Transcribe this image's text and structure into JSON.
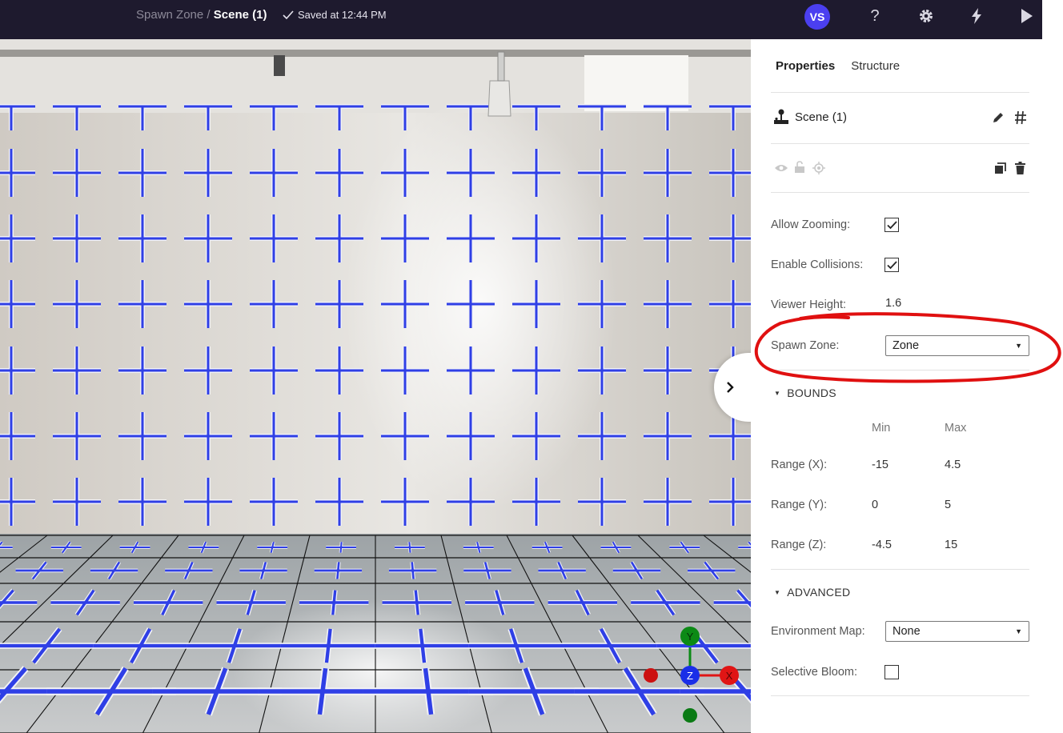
{
  "header": {
    "breadcrumb_parent": "Spawn Zone",
    "breadcrumb_separator": " / ",
    "breadcrumb_current": "Scene (1)",
    "saved_status": "Saved at 12:44 PM",
    "avatar_initials": "VS",
    "help_glyph": "?"
  },
  "panel": {
    "tabs": [
      {
        "label": "Properties",
        "active": true
      },
      {
        "label": "Structure",
        "active": false
      }
    ],
    "object_name": "Scene (1)",
    "object_icon": "joystick-icon",
    "properties": {
      "allow_zooming_label": "Allow Zooming:",
      "allow_zooming": true,
      "enable_collisions_label": "Enable Collisions:",
      "enable_collisions": true,
      "viewer_height_label": "Viewer Height:",
      "viewer_height": "1.6",
      "spawn_zone_label": "Spawn Zone:",
      "spawn_zone_value": "Zone"
    },
    "bounds": {
      "title": "BOUNDS",
      "min_header": "Min",
      "max_header": "Max",
      "rows": [
        {
          "label": "Range (X):",
          "min": "-15",
          "max": "4.5"
        },
        {
          "label": "Range (Y):",
          "min": "0",
          "max": "5"
        },
        {
          "label": "Range (Z):",
          "min": "-4.5",
          "max": "15"
        }
      ]
    },
    "advanced": {
      "title": "ADVANCED",
      "environment_map_label": "Environment Map:",
      "environment_map_value": "None",
      "selective_bloom_label": "Selective Bloom:",
      "selective_bloom": false
    }
  },
  "gizmo": {
    "y_label": "Y",
    "z_label": "Z",
    "x_label": "X",
    "colors": {
      "x": "#e01515",
      "y": "#0c8a16",
      "z": "#1a2ee8"
    }
  },
  "colors": {
    "topbar": "#1e1a2e",
    "avatar": "#4b3ff0",
    "cross": "#2f3fe6",
    "annotation": "#e01010"
  }
}
